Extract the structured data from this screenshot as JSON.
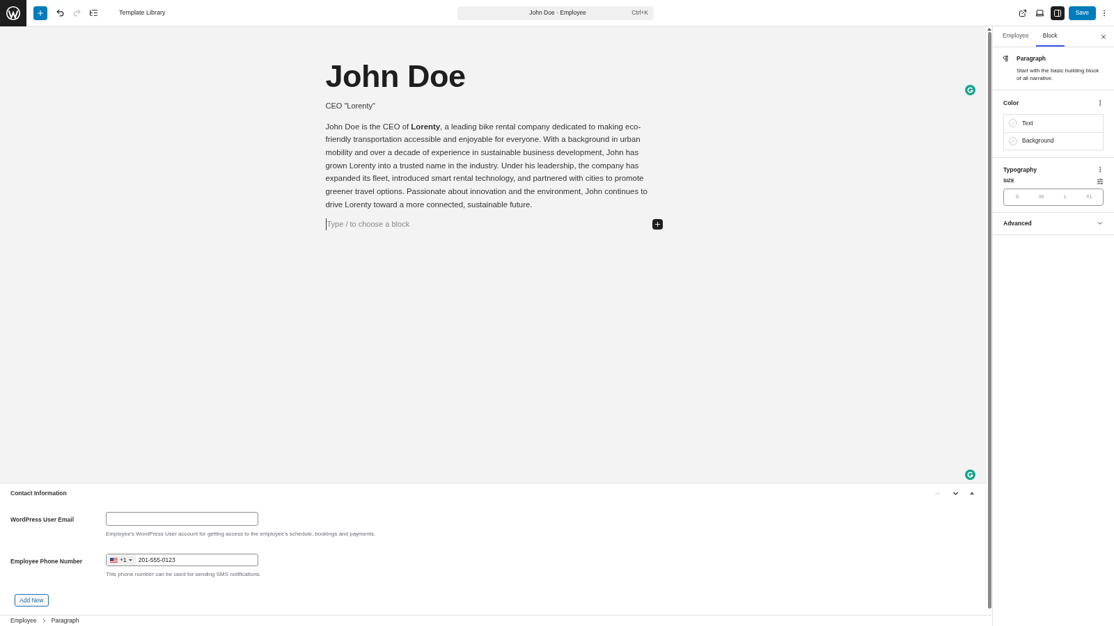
{
  "toolbar": {
    "document_title": "Template Library",
    "command": {
      "title": "John Doe · Employee",
      "shortcut": "Ctrl+K"
    },
    "redo_disabled": true,
    "settings_on": true,
    "save": "Save"
  },
  "post": {
    "title": "John Doe",
    "subtitle": "CEO \"Lorenty\"",
    "body": "John Doe is the CEO of **Lorenty**, a leading bike rental company dedicated to making eco-friendly transportation accessible and enjoyable for everyone. With a background in urban mobility and over a decade of experience in sustainable business development, John has grown Lorenty into a trusted name in the industry. Under his leadership, the company has expanded its fleet, introduced smart rental technology, and partnered with cities to promote greener travel options. Passionate about innovation and the environment, John continues to drive Lorenty toward a more connected, sustainable future.",
    "placeholder": "Type / to choose a block"
  },
  "meta_box": {
    "title": "Contact Information",
    "move_up_disabled": true,
    "fields": [
      {
        "kind": "email",
        "label": "WordPress User Email",
        "help": "Employee's WordPress User account for getting access to the employee's schedule, bookings and payments."
      },
      {
        "kind": "phone",
        "label": "Employee Phone Number",
        "dial_code": "+1",
        "value": "201-555-0123",
        "help": "This phone number can be used for sending SMS notifications."
      }
    ],
    "add_button": "Add New"
  },
  "breadcrumbs": [
    "Employee",
    "Paragraph"
  ],
  "sidebar": {
    "tabs": [
      {
        "label": "Employee",
        "selected": false
      },
      {
        "label": "Block",
        "selected": true
      }
    ],
    "block": {
      "name": "Paragraph",
      "description": "Start with the basic building block of all narrative."
    },
    "color": {
      "title": "Color",
      "items": [
        "Text",
        "Background"
      ]
    },
    "typography": {
      "title": "Typography",
      "size_label": "SIZE",
      "sizes": [
        {
          "label": "S",
          "selected": false
        },
        {
          "label": "M",
          "selected": false
        },
        {
          "label": "L",
          "selected": false
        },
        {
          "label": "XL",
          "selected": false
        }
      ]
    },
    "advanced": {
      "title": "Advanced",
      "expanded": false
    }
  }
}
